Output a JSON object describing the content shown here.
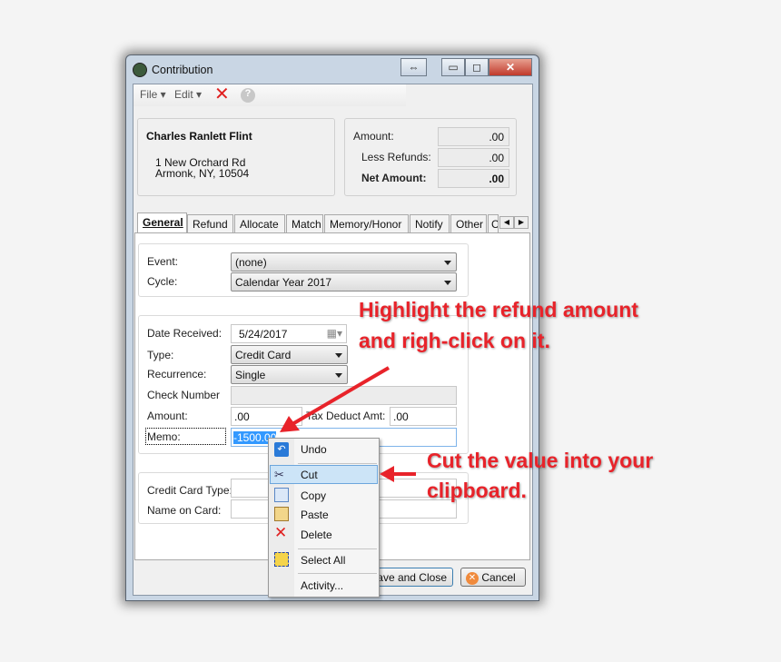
{
  "window": {
    "title": "Contribution"
  },
  "toolbar": {
    "file": "File",
    "edit": "Edit"
  },
  "constituent": {
    "name": "Charles Ranlett Flint",
    "address_line1": "1 New Orchard Rd",
    "address_line2": "Armonk, NY, 10504"
  },
  "summary": {
    "amount_label": "Amount:",
    "amount": ".00",
    "refunds_label": "Less Refunds:",
    "refunds": ".00",
    "net_label": "Net Amount:",
    "net": ".00"
  },
  "tabs": [
    "General",
    "Refund",
    "Allocate",
    "Match",
    "Memory/Honor",
    "Notify",
    "Other",
    "C"
  ],
  "form": {
    "event_label": "Event:",
    "event": "(none)",
    "cycle_label": "Cycle:",
    "cycle": "Calendar Year 2017",
    "date_label": "Date Received:",
    "date": "5/24/2017",
    "type_label": "Type:",
    "type": "Credit Card",
    "recurrence_label": "Recurrence:",
    "recurrence": "Single",
    "check_label": "Check Number",
    "check": "",
    "amount_label": "Amount:",
    "amount": ".00",
    "tax_label": "Tax Deduct Amt:",
    "tax": ".00",
    "memo_label": "Memo:",
    "memo": "-1500.00",
    "cc_type_label": "Credit Card Type:",
    "name_on_card_label": "Name on Card:"
  },
  "buttons": {
    "save_close": "Save and Close",
    "cancel": "Cancel"
  },
  "context_menu": [
    "Undo",
    "Cut",
    "Copy",
    "Paste",
    "Delete",
    "Select All",
    "Activity..."
  ],
  "annotations": {
    "a1_line1": "Highlight the refund amount",
    "a1_line2": "and righ-click on it.",
    "a2_line1": "Cut the value into your",
    "a2_line2": "clipboard."
  },
  "colors": {
    "annotation": "#e8232a",
    "selection": "#3399ff",
    "menu_highlight": "#cce4f7"
  }
}
